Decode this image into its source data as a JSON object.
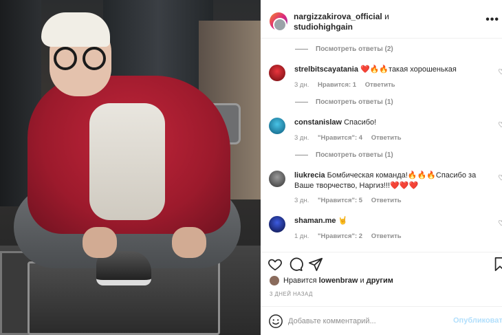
{
  "post": {
    "header": {
      "user1": "nargizzakirova_official",
      "conj": "и",
      "user2": "studiohighgain",
      "more_icon": "more-dots-icon"
    },
    "comments": [
      {
        "replies": "Посмотреть ответы (2)"
      },
      {
        "username": "strelbitscayatania",
        "text": "❤️🔥🔥такая хорошенькая",
        "time": "3 дн.",
        "likes": "Нравится: 1",
        "reply": "Ответить",
        "avatar_color": "#b5121b",
        "replies": "Посмотреть ответы (1)"
      },
      {
        "username": "constanislaw",
        "text": "Спасибо!",
        "time": "3 дн.",
        "likes": "\"Нравится\": 4",
        "reply": "Ответить",
        "avatar_color": "#1a8fb8",
        "replies": "Посмотреть ответы (1)"
      },
      {
        "username": "liukrecia",
        "text": "Бомбическая команда!🔥🔥🔥Спасибо за Ваше творчество, Наргиз!!!❤️❤️❤️",
        "time": "3 дн.",
        "likes": "\"Нравится\": 5",
        "reply": "Ответить",
        "avatar_color": "#5a5a5a"
      },
      {
        "username": "shaman.me",
        "text": "🤘",
        "time": "1 дн.",
        "likes": "\"Нравится\": 2",
        "reply": "Ответить",
        "avatar_color": "#1b2a8a"
      }
    ],
    "likes": {
      "prefix": "Нравится",
      "user": "lowenbraw",
      "suffix": "и",
      "others": "другим"
    },
    "date": "3 ДНЕЙ НАЗАД",
    "add_comment": {
      "placeholder": "Добавьте комментарий...",
      "publish": "Опубликовать"
    },
    "colors": {
      "link_disabled": "#b2dffc",
      "secondary_text": "#8e8e8e"
    }
  }
}
